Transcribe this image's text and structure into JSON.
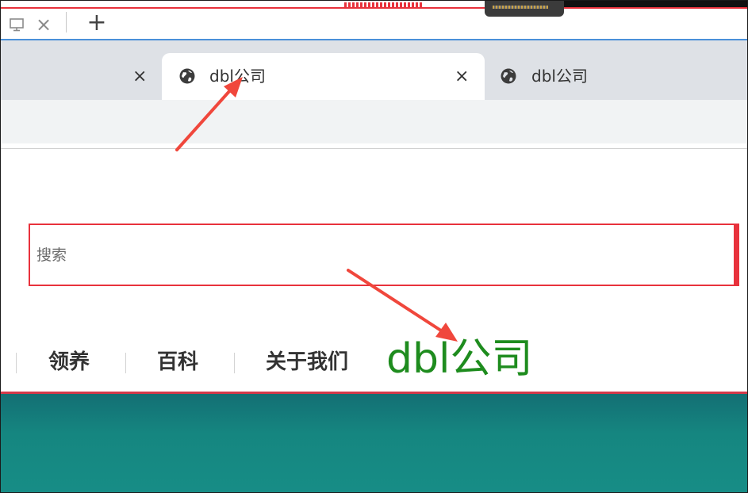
{
  "browser": {
    "new_tab_glyph": "+",
    "close_glyph": "×",
    "tabs": [
      {
        "title": "",
        "close": "×",
        "active": false
      },
      {
        "title": "dbl公司",
        "close": "×",
        "active": true
      },
      {
        "title": "dbl公司",
        "active": false
      }
    ]
  },
  "page": {
    "search": {
      "placeholder": "搜索",
      "value": ""
    },
    "nav": [
      "领养",
      "百科",
      "关于我们"
    ],
    "brand": "dbl公司"
  },
  "icons": {
    "window": "monitor-icon",
    "close": "close-icon",
    "new_tab": "plus-icon",
    "tab_favicon": "globe-icon"
  },
  "colors": {
    "annotation_red": "#e8323c",
    "brand_green": "#1e8c1e",
    "banner_teal": "#158680",
    "tabstrip": "#dee1e6"
  }
}
